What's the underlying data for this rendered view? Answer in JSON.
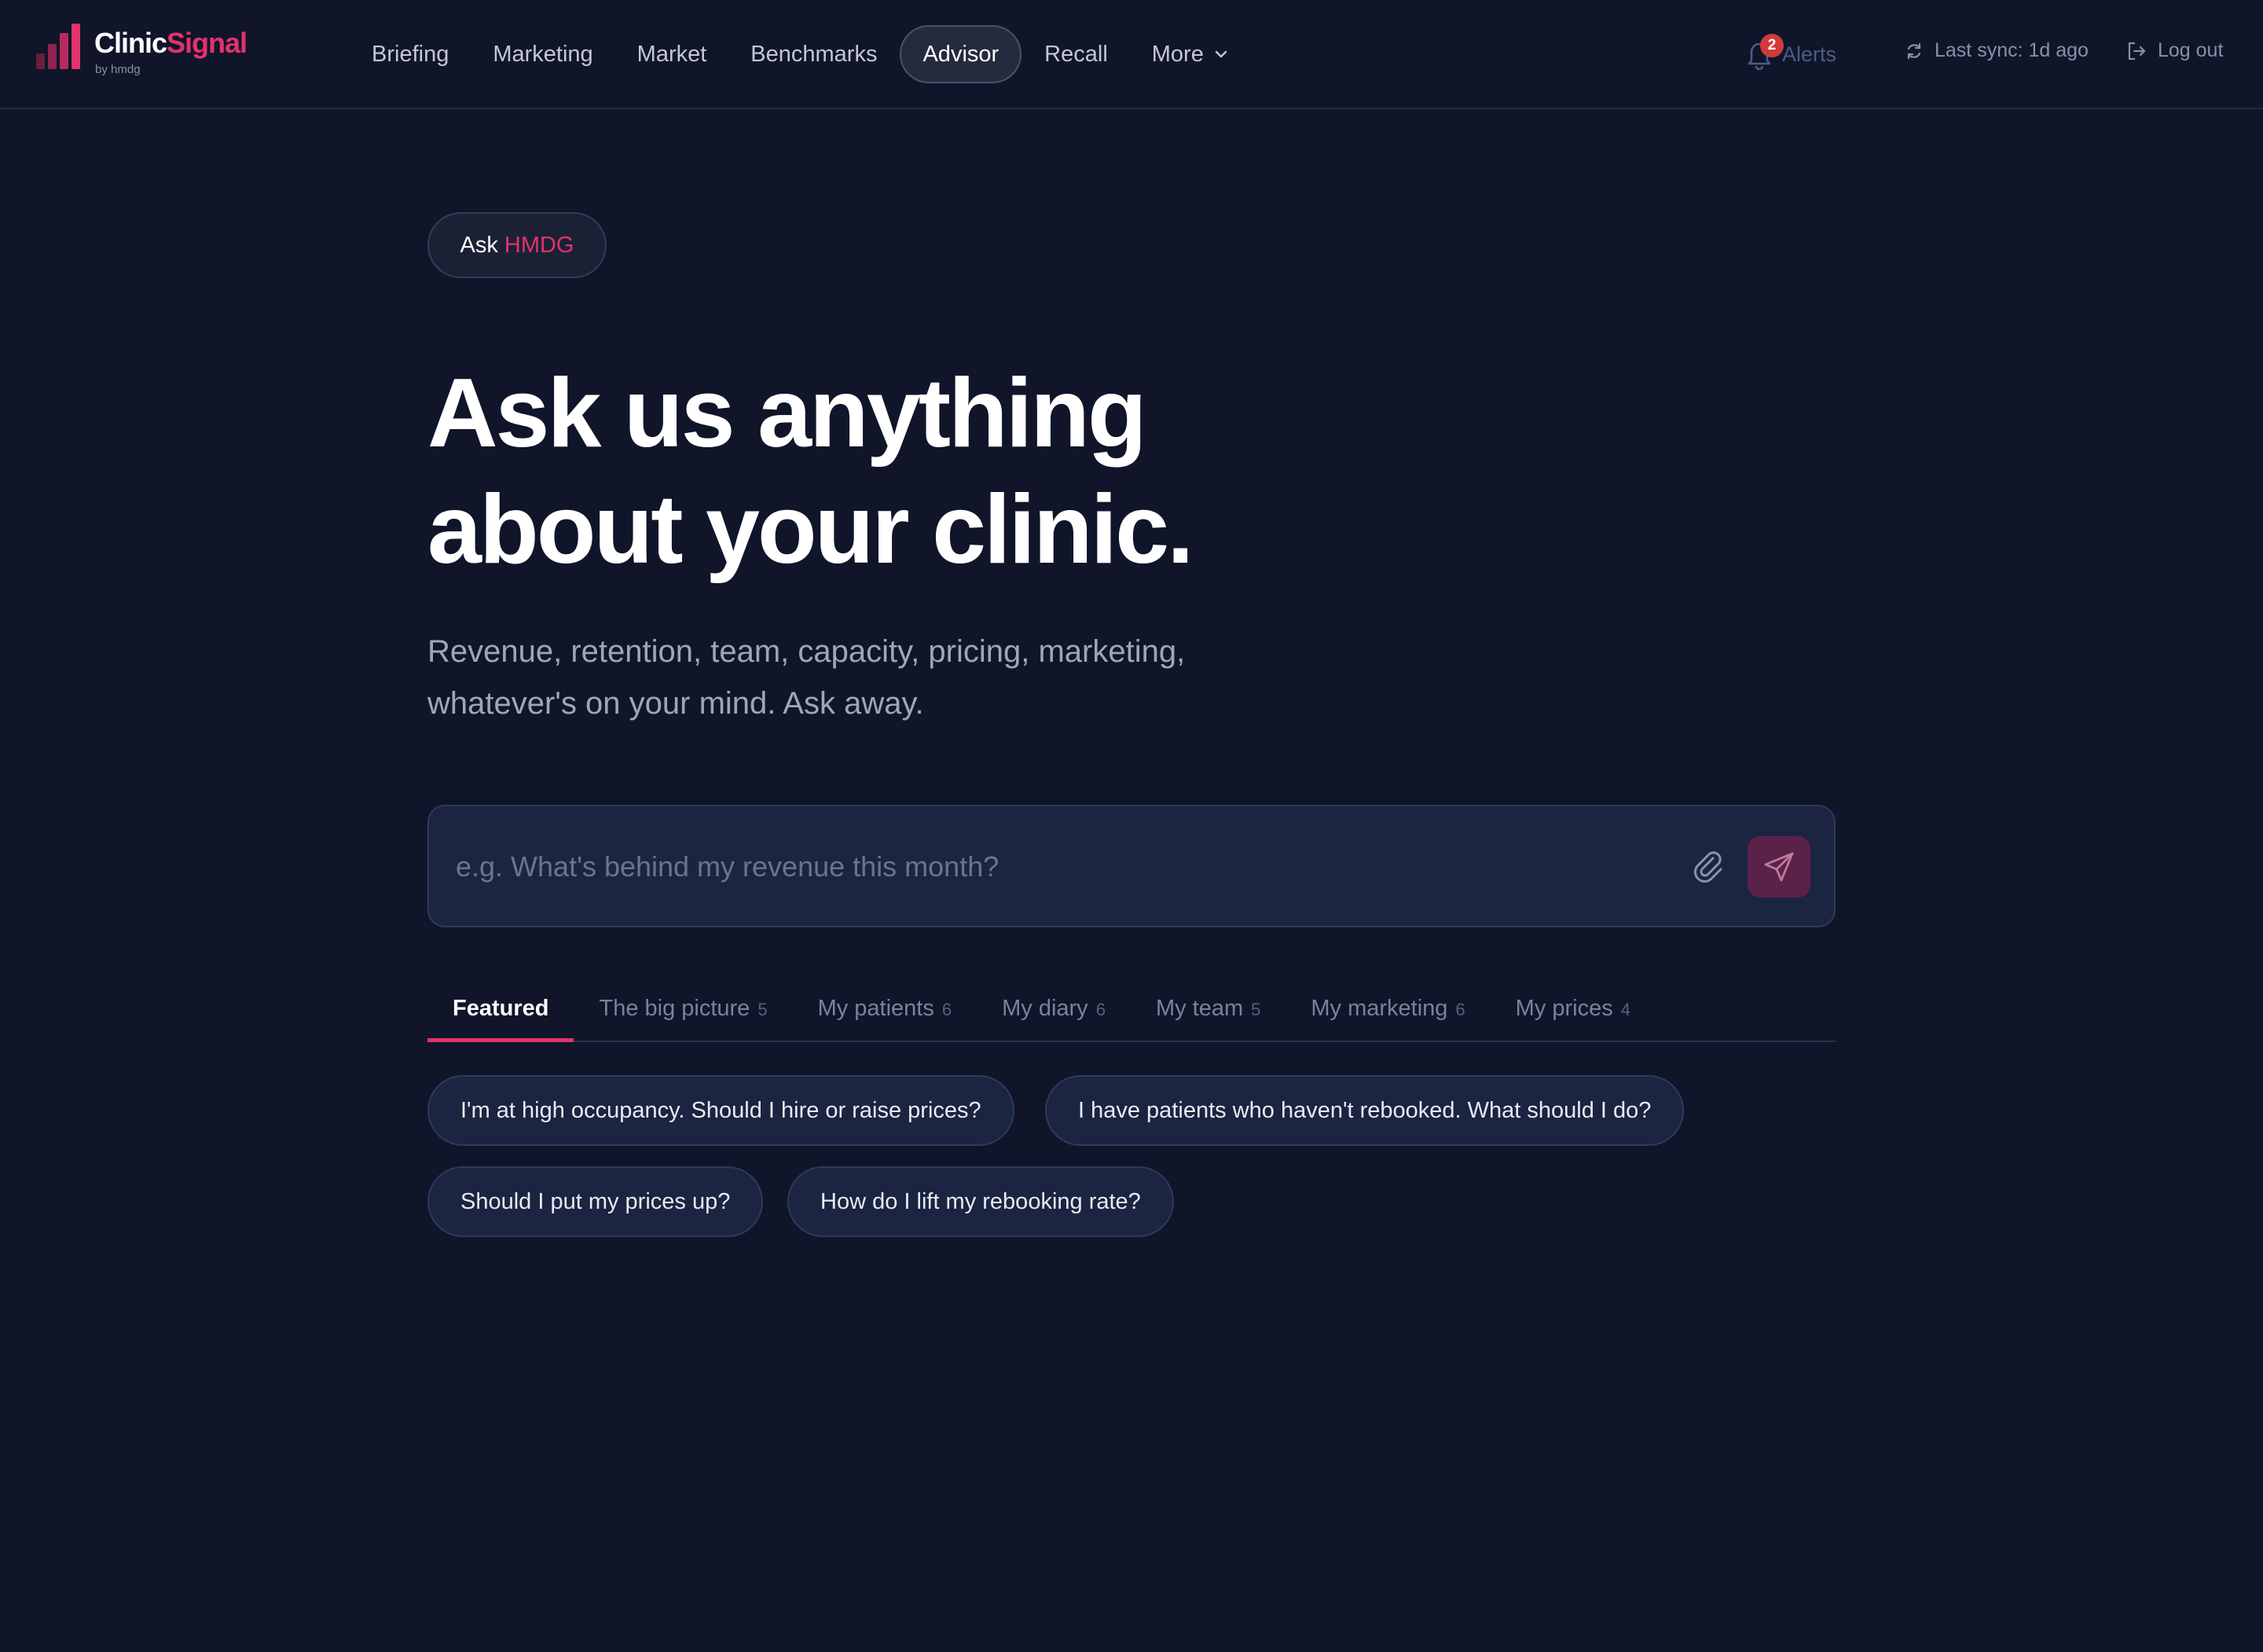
{
  "brand": {
    "name_part1": "Clinic",
    "name_part2": "Signal",
    "sub": "by hmdg",
    "accent": "#e0336b"
  },
  "nav": {
    "items": [
      {
        "label": "Briefing"
      },
      {
        "label": "Marketing"
      },
      {
        "label": "Market"
      },
      {
        "label": "Benchmarks"
      },
      {
        "label": "Advisor",
        "active": true
      },
      {
        "label": "Recall"
      }
    ],
    "more_label": "More"
  },
  "header": {
    "alerts_label": "Alerts",
    "alerts_count": "2",
    "sync_text": "Last sync: 1d ago",
    "logout_label": "Log out"
  },
  "hero": {
    "pill_ask": "Ask",
    "pill_brand": "HMDG",
    "headline_line1": "Ask us anything",
    "headline_line2": "about your clinic.",
    "subtext_line1": "Revenue, retention, team, capacity, pricing, marketing,",
    "subtext_line2": "whatever's on your mind. Ask away."
  },
  "search": {
    "placeholder": "e.g. What's behind my revenue this month?",
    "value": ""
  },
  "tabs": [
    {
      "label": "Featured",
      "count": "",
      "active": true
    },
    {
      "label": "The big picture",
      "count": "5"
    },
    {
      "label": "My patients",
      "count": "6"
    },
    {
      "label": "My diary",
      "count": "6"
    },
    {
      "label": "My team",
      "count": "5"
    },
    {
      "label": "My marketing",
      "count": "6"
    },
    {
      "label": "My prices",
      "count": "4"
    }
  ],
  "suggestions": [
    "I'm at high occupancy. Should I hire or raise prices?",
    "I have patients who haven't rebooked. What should I do?",
    "Should I put my prices up?",
    "How do I lift my rebooking rate?"
  ],
  "colors": {
    "background": "#10152a",
    "accent": "#e0336b",
    "send_button": "#5a2149"
  }
}
